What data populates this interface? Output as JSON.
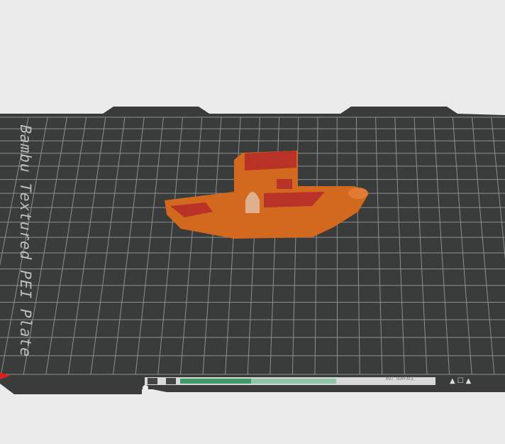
{
  "viewport": {
    "title": "3D build plate view"
  },
  "plate": {
    "label": "Bambu Textured PEI Plate",
    "warning": "HOT SURFACE",
    "colors": {
      "plate": "#3a3b3b",
      "grid": "#8e8f8f",
      "model": "#d2691e",
      "model_infill": "#b83228",
      "background": "#ebebeb"
    }
  },
  "model": {
    "name": "benchy-boat-model"
  },
  "icons": [
    "origin-axis-icon",
    "plate-corner-icons"
  ]
}
